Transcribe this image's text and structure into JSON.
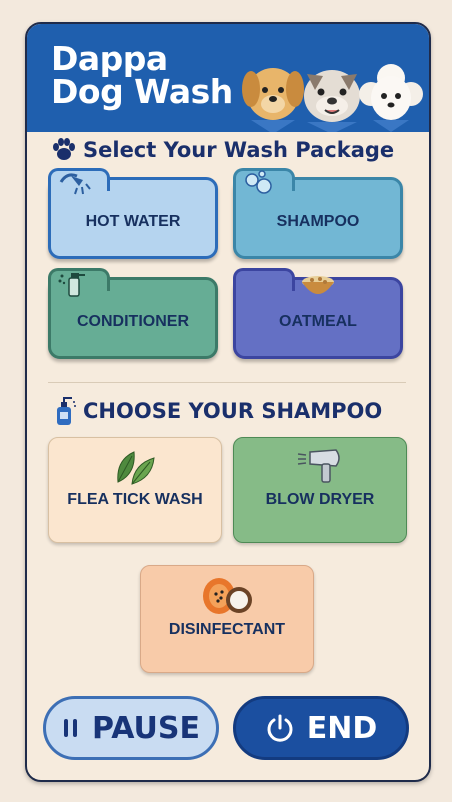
{
  "header": {
    "title_line1": "Dappa",
    "title_line2": "Dog Wash"
  },
  "wash_section": {
    "title": "Select Your Wash Package"
  },
  "packages": [
    {
      "label": "HOT WATER",
      "icon": "shower-icon"
    },
    {
      "label": "SHAMPOO",
      "icon": "bubbles-icon"
    },
    {
      "label": "CONDITIONER",
      "icon": "spray-bottle-icon"
    },
    {
      "label": "OATMEAL",
      "icon": "oatmeal-bowl-icon"
    }
  ],
  "shampoo_section": {
    "title": "CHOOSE YOUR SHAMPOO"
  },
  "options": [
    {
      "label": "FLEA TICK WASH",
      "icon": "leaves-icon"
    },
    {
      "label": "BLOW DRYER",
      "icon": "hair-dryer-icon"
    },
    {
      "label": "DISINFECTANT",
      "icon": "papaya-coconut-icon"
    }
  ],
  "controls": {
    "pause_label": "PAUSE",
    "end_label": "END"
  },
  "colors": {
    "brand_blue": "#1f5fae",
    "text_navy": "#17305f",
    "background": "#f6ebdd"
  }
}
